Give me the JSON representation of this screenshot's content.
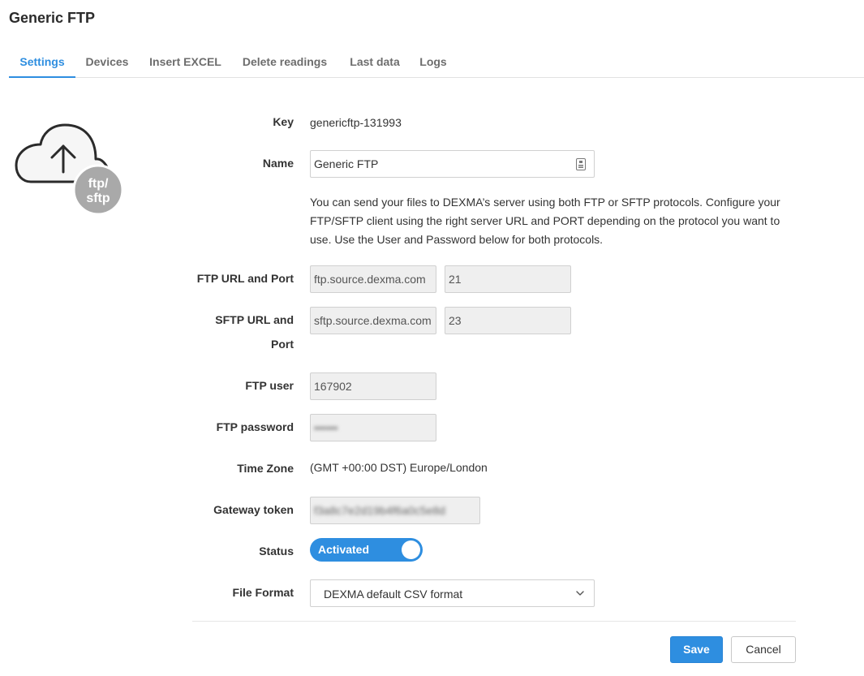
{
  "page": {
    "title": "Generic FTP"
  },
  "tabs": [
    {
      "label": "Settings",
      "active": true
    },
    {
      "label": "Devices"
    },
    {
      "label": "Insert EXCEL"
    },
    {
      "label": "Delete readings"
    },
    {
      "label": "Last data"
    },
    {
      "label": "Logs"
    }
  ],
  "logo": {
    "icon": "cloud-upload-icon",
    "badge_line1": "ftp/",
    "badge_line2": "sftp"
  },
  "form": {
    "key": {
      "label": "Key",
      "value": "genericftp-131993"
    },
    "name": {
      "label": "Name",
      "value": "Generic FTP",
      "icon": "contact-card-icon"
    },
    "info": "You can send your files to DEXMA’s server using both FTP or SFTP protocols. Configure your FTP/SFTP client using the right server URL and PORT depending on the protocol you want to use. Use the User and Password below for both protocols.",
    "ftp_url": {
      "label": "FTP URL and Port",
      "url": "ftp.source.dexma.com",
      "port": "21"
    },
    "sftp_url": {
      "label_line1": "SFTP URL and",
      "label_line2": "Port",
      "url": "sftp.source.dexma.com",
      "port": "23"
    },
    "ftp_user": {
      "label": "FTP user",
      "value": "167902"
    },
    "ftp_password": {
      "label": "FTP password",
      "value": "••••••"
    },
    "time_zone": {
      "label": "Time Zone",
      "value": "(GMT +00:00 DST) Europe/London"
    },
    "gateway_token": {
      "label": "Gateway token",
      "value": "f3a8c7e2d19b4f6a0c5e8d"
    },
    "status": {
      "label": "Status",
      "value": "Activated",
      "on": true
    },
    "file_format": {
      "label": "File Format",
      "selected": "DEXMA default CSV format"
    }
  },
  "actions": {
    "save": "Save",
    "cancel": "Cancel"
  },
  "colors": {
    "accent": "#2e8ee0",
    "disabled_bg": "#efefef",
    "logo_gray": "#a9a9a9"
  }
}
